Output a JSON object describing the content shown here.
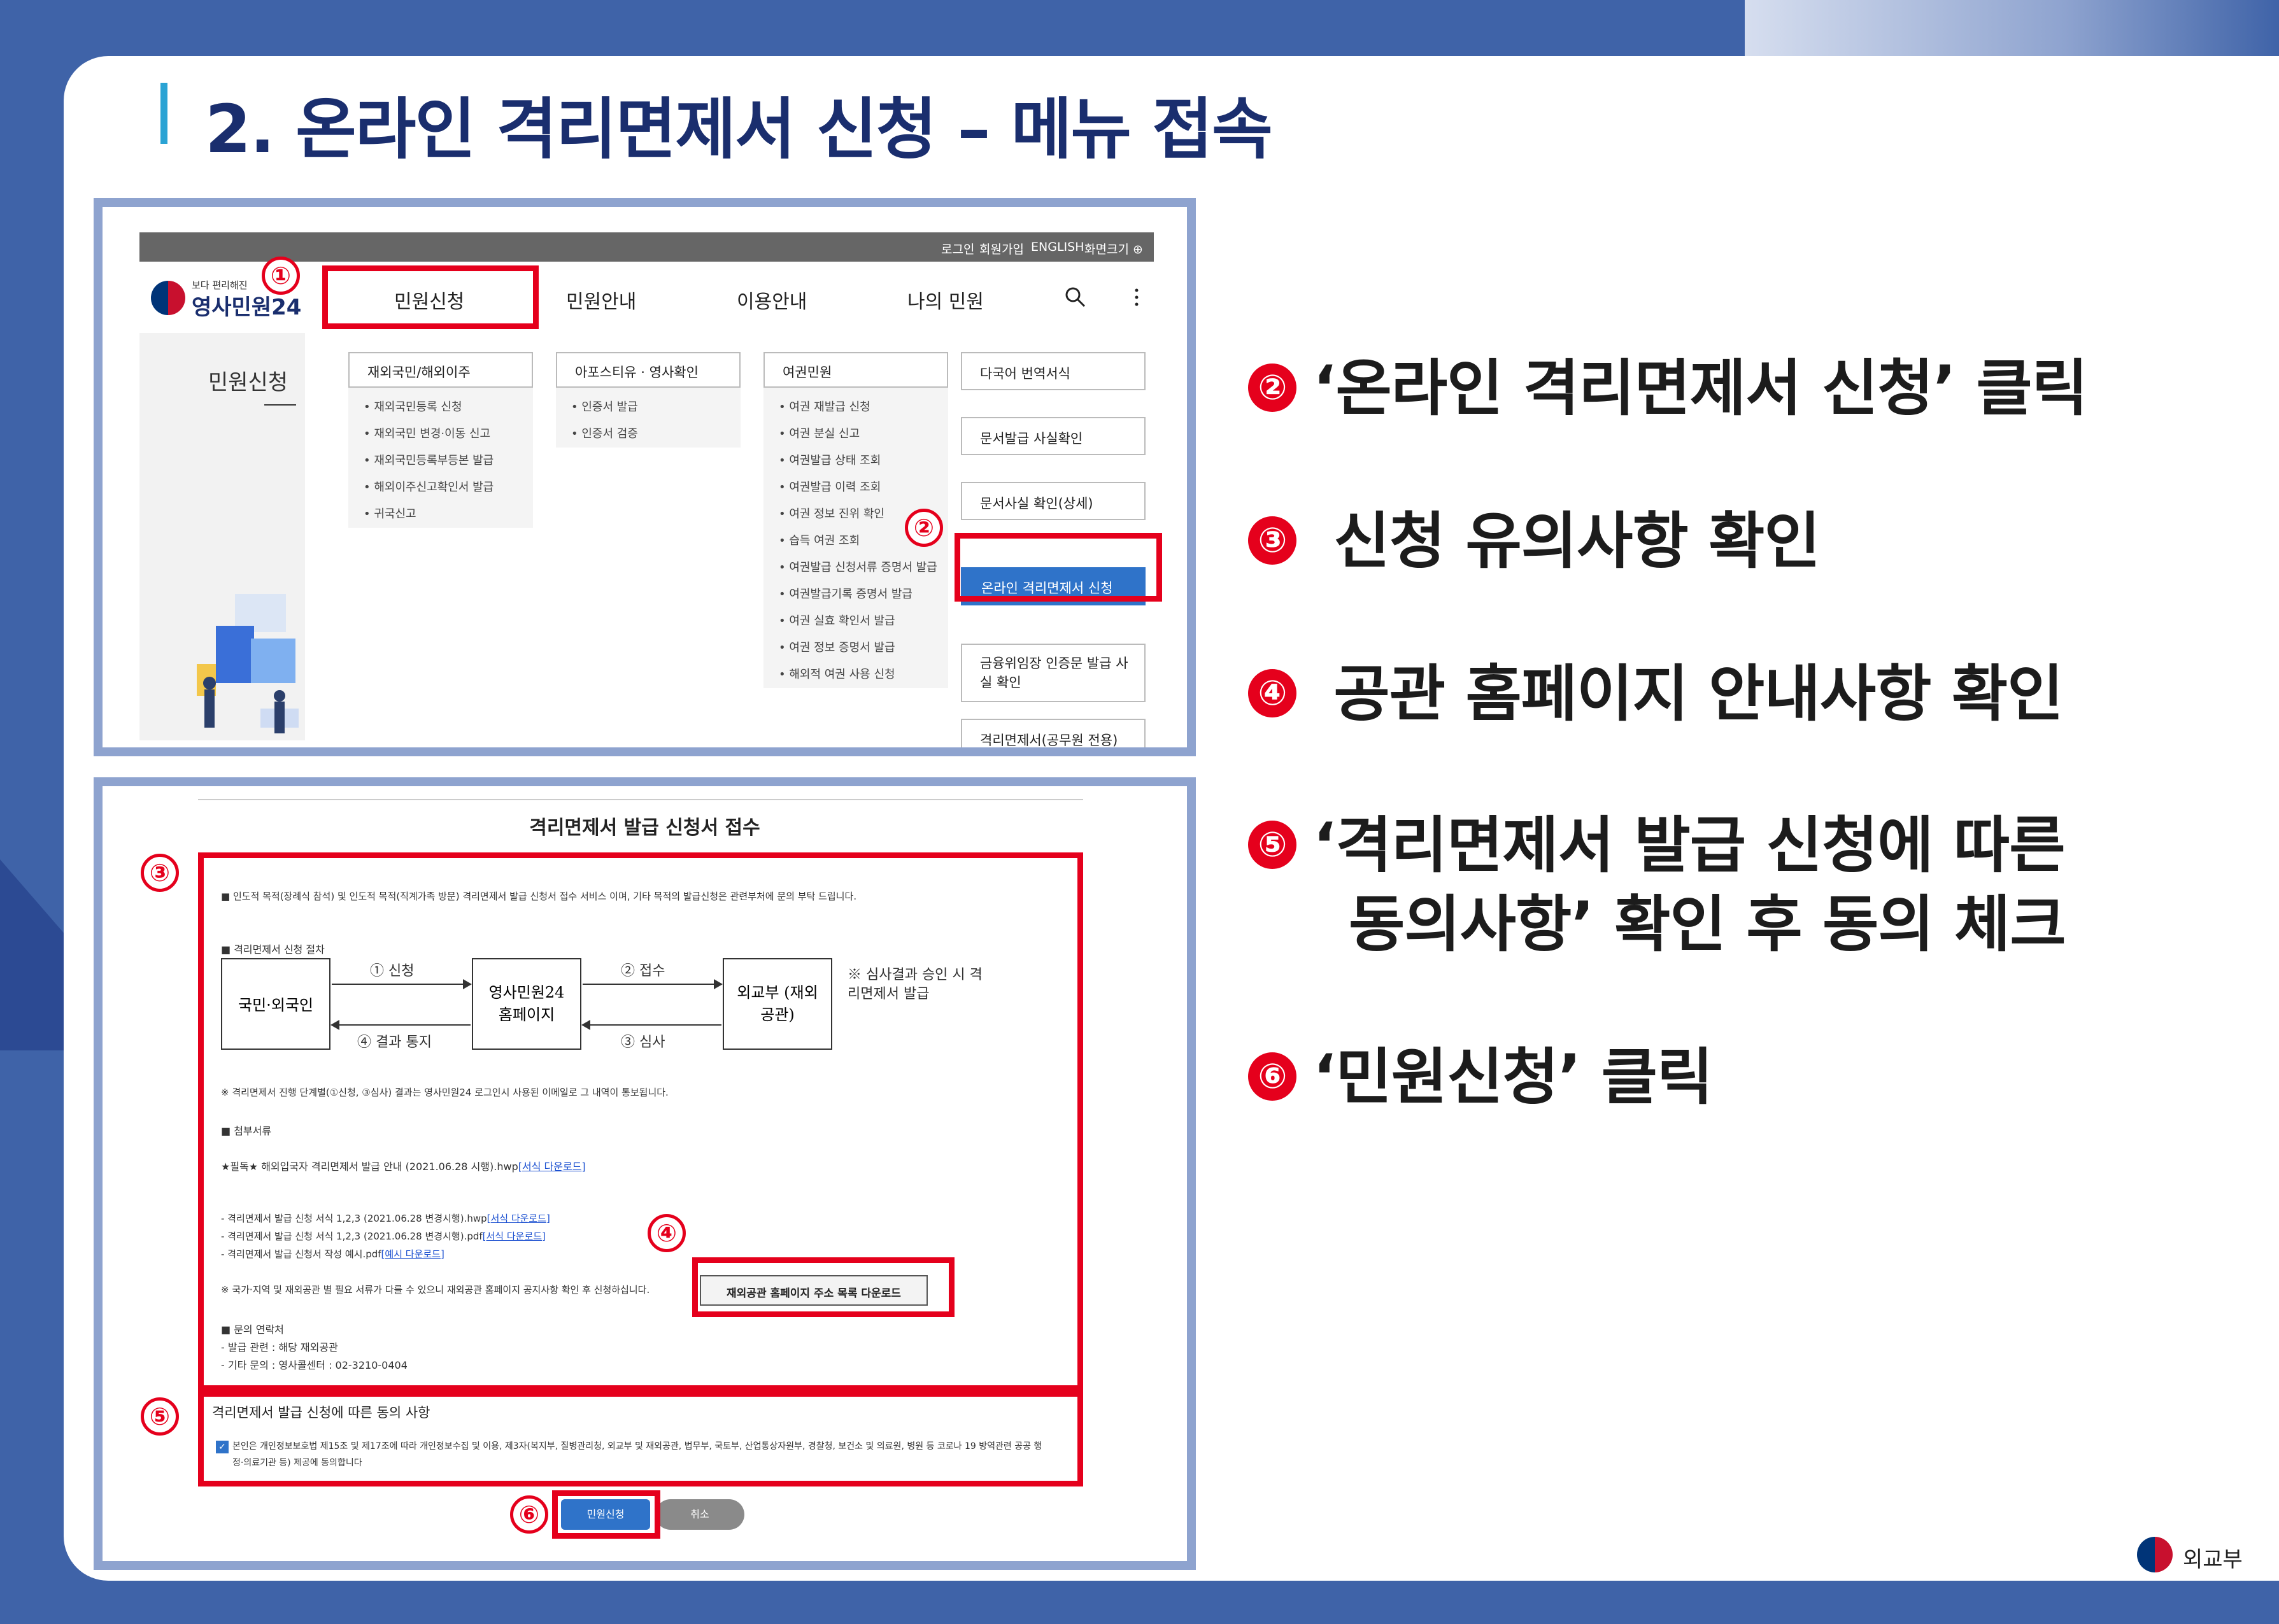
{
  "title": "2. 온라인 격리면제서 신청 – 메뉴 접속",
  "site": {
    "topbar": [
      "로그인",
      "회원가입",
      "ENGLISH",
      "화면크기 ⊕"
    ],
    "logo_small": "보다 편리해진",
    "logo_main": "영사민원24",
    "nav": [
      "민원신청",
      "민원안내",
      "이용안내",
      "나의 민원"
    ],
    "left_title": "민원신청",
    "columns": [
      {
        "head": "재외국민/해외이주",
        "items": [
          "재외국민등록 신청",
          "재외국민 변경·이동 신고",
          "재외국민등록부등본 발급",
          "해외이주신고확인서 발급",
          "귀국신고"
        ]
      },
      {
        "head": "아포스티유 · 영사확인",
        "items": [
          "인증서 발급",
          "인증서 검증"
        ]
      },
      {
        "head": "여권민원",
        "items": [
          "여권 재발급 신청",
          "여권 분실 신고",
          "여권발급 상태 조회",
          "여권발급 이력 조회",
          "여권 정보 진위 확인",
          "습득 여권 조회",
          "여권발급 신청서류 증명서 발급",
          "여권발급기록 증명서 발급",
          "여권 실효 확인서 발급",
          "여권 정보 증명서 발급",
          "해외적 여권 사용 신청"
        ]
      }
    ],
    "right_buttons": [
      "다국어 번역서식",
      "문서발급 사실확인",
      "문서사실 확인(상세)",
      "온라인 격리면제서 신청",
      "금융위임장 인증문 발급 사실 확인",
      "격리면제서(공무원 전용)"
    ]
  },
  "form": {
    "title": "격리면제서 발급 신청서 접수",
    "intro": "■ 인도적 목적(장례식 참석) 및 인도적 목적(직계가족 방문) 격리면제서 발급 신청서 접수 서비스 이며, 기타 목적의 발급신청은 관련부처에 문의 부탁 드립니다.",
    "procedure_head": "■ 격리면제서 신청 절차",
    "flow": {
      "left": "국민·외국인",
      "middle": "영사민원24 홈페이지",
      "right": "외교부 (재외공관)",
      "apply": "① 신청",
      "receive": "② 접수",
      "review": "③ 심사",
      "notify": "④ 결과 통지",
      "note": "※ 심사결과 승인 시 격리면제서 발급"
    },
    "notice1": "※ 격리면제서 진행 단계별(①신청, ③심사) 결과는 영사민원24 로그인시 사용된 이메일로 그 내역이 통보됩니다.",
    "attach_head": "■ 첨부서류",
    "must": "★필독★ 해외입국자 격리면제서 발급 안내 (2021.06.28 시행).hwp",
    "download": "[서식 다운로드]",
    "files": [
      {
        "text": "- 격리면제서 발급 신청 서식 1,2,3 (2021.06.28 변경시행).hwp",
        "link": "[서식 다운로드]"
      },
      {
        "text": "- 격리면제서 발급 신청 서식 1,2,3 (2021.06.28 변경시행).pdf",
        "link": "[서식 다운로드]"
      },
      {
        "text": "- 격리면제서 발급 신청서 작성 예시.pdf",
        "link": "[예시 다운로드]"
      }
    ],
    "notice2": "※ 국가·지역 및 재외공관 별 필요 서류가 다를 수 있으니 재외공관 홈페이지 공지사항 확인 후 신청하십니다.",
    "embassy_button": "재외공관 홈페이지 주소 목록 다운로드",
    "contact_head": "■ 문의 연락처",
    "contact1": "- 발급 관련 : 해당 재외공관",
    "contact2": "- 기타 문의 : 영사콜센터 : 02-3210-0404",
    "consent_head": "격리면제서 발급 신청에 따른 동의 사항",
    "consent_line1": "본인은 개인정보보호법 제15조 및 제17조에 따라 개인정보수집 및 이용, 제3자(복지부, 질병관리청, 외교부 및 재외공관, 법무부, 국토부, 산업통상자원부, 경찰청, 보건소 및 의료원, 병원 등 코로나 19 방역관련 공공 행",
    "consent_line2": "정·의료기관 등) 제공에 동의합니다",
    "submit": "민원신청",
    "cancel": "취소"
  },
  "markers": [
    "①",
    "②",
    "③",
    "④",
    "⑤",
    "⑥"
  ],
  "steps": [
    {
      "num": "②",
      "text": "‘온라인 격리면제서 신청’ 클릭"
    },
    {
      "num": "③",
      "text": " 신청 유의사항 확인"
    },
    {
      "num": "④",
      "text": " 공관 홈페이지 안내사항 확인"
    },
    {
      "num": "⑤",
      "text": "‘격리면제서 발급 신청에 따른"
    },
    {
      "num": "",
      "text": "동의사항’ 확인 후 동의 체크"
    },
    {
      "num": "⑥",
      "text": "‘민원신청’ 클릭"
    }
  ],
  "footer": "외교부",
  "colors": {
    "accent": "#e5001c",
    "navy": "#1a2e6e",
    "frame": "#8ea3cf",
    "button_blue": "#2f73c9",
    "background": "#3f63a8"
  }
}
